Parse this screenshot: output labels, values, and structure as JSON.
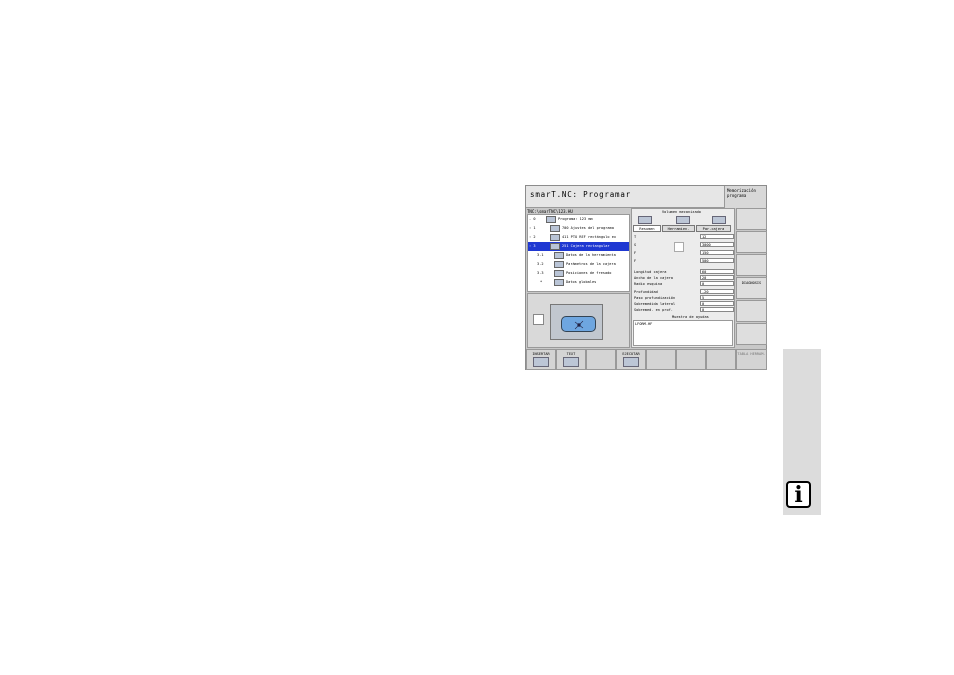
{
  "window": {
    "title": "smarT.NC: Programar",
    "mode_label": "Memorización programa"
  },
  "path": "TNC:\\smarTNC\\123.HU",
  "tree": [
    {
      "num": "- 0",
      "label": "Programa: 123 mm",
      "selected": false
    },
    {
      "num": ": 1",
      "label": "700 Ajustes del programa",
      "selected": false
    },
    {
      "num": ": 2",
      "label": "411 PTO REF rectángulo ex",
      "selected": false
    },
    {
      "num": ": 3",
      "label": "251 Cajera rectangular",
      "selected": true
    },
    {
      "num": "3.1",
      "label": "Datos de la herramienta",
      "selected": false
    },
    {
      "num": "3.2",
      "label": "Parámetros de la cajera",
      "selected": false
    },
    {
      "num": "3.3",
      "label": "Posiciones de fresado",
      "selected": false
    },
    {
      "num": "*",
      "label": "Datos globales",
      "selected": false
    }
  ],
  "form": {
    "workpiece_title": "Volumen mecanizado",
    "tabs": [
      "Resumen",
      "Herramien.",
      "Par.cajera"
    ],
    "fields_top": [
      {
        "label": "T",
        "value": "12"
      },
      {
        "label": "S",
        "value": "3000"
      },
      {
        "label": "F",
        "value": "150"
      },
      {
        "label": "F",
        "value": "500"
      }
    ],
    "fields": [
      {
        "label": "Longitud cajera",
        "value": "60"
      },
      {
        "label": "Ancho de la cajera",
        "value": "20"
      },
      {
        "label": "Radio esquina",
        "value": "0"
      },
      {
        "label": "Profundidad",
        "value": "-20"
      },
      {
        "label": "Paso profundización",
        "value": "5"
      },
      {
        "label": "Sobremedida lateral",
        "value": "0"
      },
      {
        "label": "Sobremed. en prof.",
        "value": "0"
      }
    ],
    "section_title": "Muestra de ayudas",
    "note": "LFORM.HF"
  },
  "side_softkeys": [
    "",
    "",
    "",
    "DIAGNOSIS",
    "",
    ""
  ],
  "bottom_softkeys": [
    {
      "label": "INSERTAR"
    },
    {
      "label": "TEXT"
    },
    {
      "label": ""
    },
    {
      "label": "EJECUTAR"
    },
    {
      "label": ""
    },
    {
      "label": ""
    },
    {
      "label": ""
    },
    {
      "label": "TABLA HERRAM."
    }
  ],
  "info_icon": "i"
}
